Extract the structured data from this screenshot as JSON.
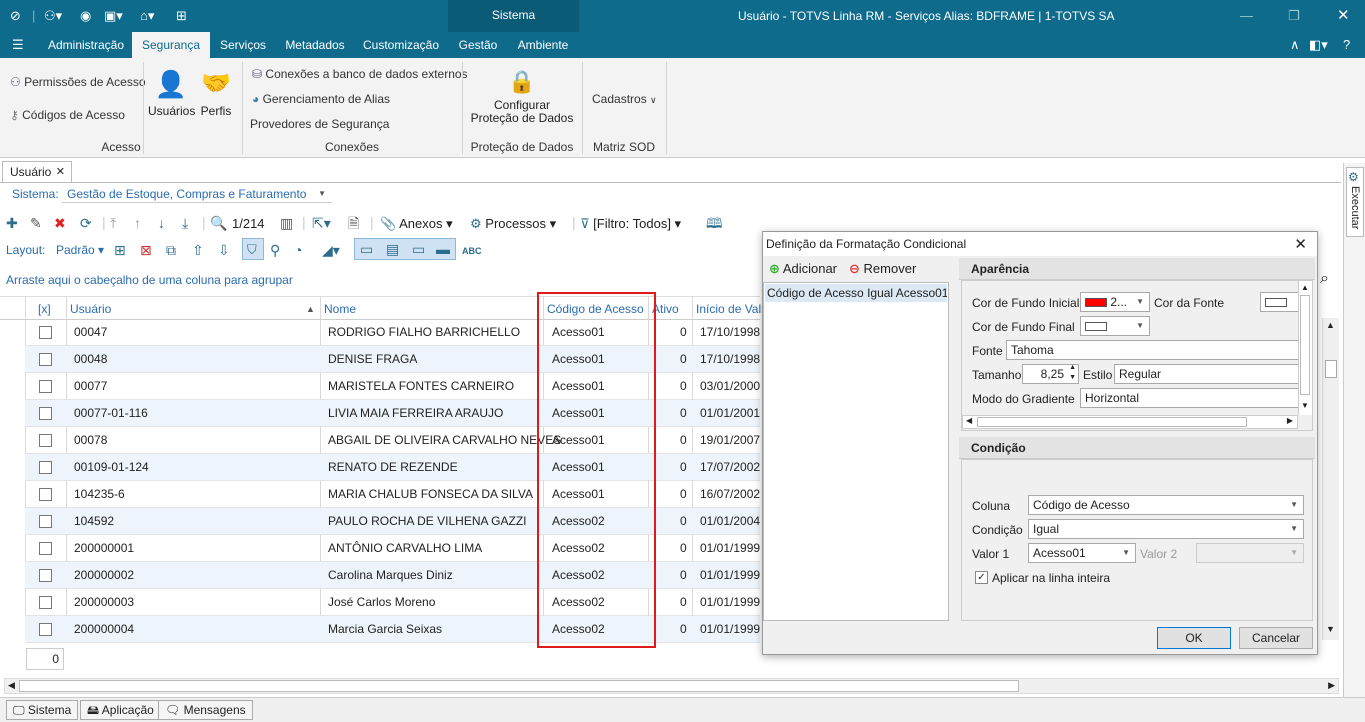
{
  "titlebar": {
    "center_tab": "Sistema",
    "title": "Usuário - TOTVS Linha RM - Serviços  Alias: BDFRAME | 1-TOTVS SA"
  },
  "menu": [
    "Administração",
    "Segurança",
    "Serviços",
    "Metadados",
    "Customização",
    "Gestão",
    "Ambiente"
  ],
  "ribbon": {
    "acesso": {
      "items": [
        "Permissões de Acesso",
        "Códigos de Acesso"
      ],
      "big": [
        "Usuários",
        "Perfis"
      ],
      "group": "Acesso"
    },
    "conexoes": {
      "items": [
        "Conexões a banco de dados externos",
        "Gerenciamento de Alias",
        "Provedores de Segurança"
      ],
      "group": "Conexões"
    },
    "protecao": {
      "label1": "Configurar",
      "label2": "Proteção de Dados",
      "group": "Proteção de Dados"
    },
    "matriz": {
      "label": "Cadastros",
      "group": "Matriz SOD"
    }
  },
  "doc_tab": "Usuário",
  "sistema": {
    "label": "Sistema:",
    "value": "Gestão de Estoque, Compras e Faturamento"
  },
  "toolbar": {
    "count": "1/214",
    "anexos": "Anexos",
    "processos": "Processos",
    "filtro": "[Filtro: Todos]"
  },
  "layout": {
    "label": "Layout:",
    "value": "Padrão"
  },
  "group_hint": "Arraste aqui o cabeçalho de uma coluna para agrupar",
  "grid": {
    "headers": {
      "sel": "[x]",
      "usuario": "Usuário",
      "nome": "Nome",
      "codigo": "Código de Acesso",
      "ativo": "Ativo",
      "inicio": "Início de Valid"
    },
    "rows": [
      {
        "usuario": "00047",
        "nome": "RODRIGO FIALHO BARRICHELLO",
        "codigo": "Acesso01",
        "ativo": "0",
        "inicio": "17/10/1998"
      },
      {
        "usuario": "00048",
        "nome": "DENISE FRAGA",
        "codigo": "Acesso01",
        "ativo": "0",
        "inicio": "17/10/1998"
      },
      {
        "usuario": "00077",
        "nome": "MARISTELA FONTES CARNEIRO",
        "codigo": "Acesso01",
        "ativo": "0",
        "inicio": "03/01/2000"
      },
      {
        "usuario": "00077-01-116",
        "nome": "LIVIA MAIA FERREIRA ARAUJO",
        "codigo": "Acesso01",
        "ativo": "0",
        "inicio": "01/01/2001"
      },
      {
        "usuario": "00078",
        "nome": "ABGAIL DE OLIVEIRA CARVALHO NEVES",
        "codigo": "Acesso01",
        "ativo": "0",
        "inicio": "19/01/2007"
      },
      {
        "usuario": "00109-01-124",
        "nome": "RENATO DE REZENDE",
        "codigo": "Acesso01",
        "ativo": "0",
        "inicio": "17/07/2002"
      },
      {
        "usuario": "104235-6",
        "nome": "MARIA CHALUB FONSECA DA SILVA",
        "codigo": "Acesso01",
        "ativo": "0",
        "inicio": "16/07/2002"
      },
      {
        "usuario": "104592",
        "nome": "PAULO ROCHA DE VILHENA GAZZI",
        "codigo": "Acesso02",
        "ativo": "0",
        "inicio": "01/01/2004"
      },
      {
        "usuario": "200000001",
        "nome": "ANTÔNIO CARVALHO LIMA",
        "codigo": "Acesso02",
        "ativo": "0",
        "inicio": "01/01/1999"
      },
      {
        "usuario": "200000002",
        "nome": "Carolina Marques Diniz",
        "codigo": "Acesso02",
        "ativo": "0",
        "inicio": "01/01/1999"
      },
      {
        "usuario": "200000003",
        "nome": "José Carlos Moreno",
        "codigo": "Acesso02",
        "ativo": "0",
        "inicio": "01/01/1999"
      },
      {
        "usuario": "200000004",
        "nome": "Marcia Garcia Seixas",
        "codigo": "Acesso02",
        "ativo": "0",
        "inicio": "01/01/1999"
      }
    ],
    "footer_count": "0"
  },
  "side_tab": "Executar",
  "dialog": {
    "title": "Definição da Formatação Condicional",
    "adicionar": "Adicionar",
    "remover": "Remover",
    "list_item": "Código de Acesso Igual Acesso01",
    "aparencia": "Aparência",
    "cor_fundo_inicial": "Cor de Fundo Inicial",
    "cor_fundo_inicial_val": "2...",
    "cor_fonte": "Cor da Fonte",
    "cor_fundo_final": "Cor de Fundo Final",
    "fonte": "Fonte",
    "fonte_val": "Tahoma",
    "tamanho": "Tamanho",
    "tamanho_val": "8,25",
    "estilo": "Estilo",
    "estilo_val": "Regular",
    "gradiente": "Modo do Gradiente",
    "gradiente_val": "Horizontal",
    "condicao_title": "Condição",
    "coluna": "Coluna",
    "coluna_val": "Código de Acesso",
    "condicao": "Condição",
    "condicao_val": "Igual",
    "valor1": "Valor 1",
    "valor1_val": "Acesso01",
    "valor2": "Valor 2",
    "aplicar": "Aplicar na linha inteira",
    "ok": "OK",
    "cancelar": "Cancelar",
    "colors": {
      "red": "#ff0000"
    }
  },
  "status_tabs": [
    "Sistema",
    "Aplicação",
    "Mensagens"
  ]
}
